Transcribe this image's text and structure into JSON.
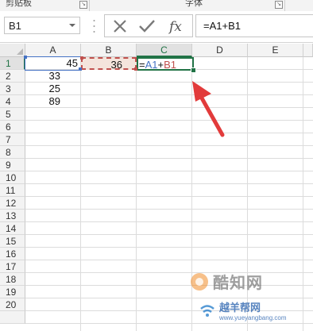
{
  "ribbon": {
    "groups": [
      {
        "label": "剪贴板"
      },
      {
        "label": "字体"
      }
    ]
  },
  "formula_bar": {
    "name_box": "B1",
    "formula": "=A1+B1"
  },
  "sheet": {
    "columns": [
      "A",
      "B",
      "C",
      "D",
      "E"
    ],
    "rows": [
      "1",
      "2",
      "3",
      "4",
      "5",
      "6",
      "7",
      "8",
      "9",
      "10",
      "11",
      "12",
      "13",
      "14",
      "15",
      "16",
      "17",
      "18",
      "19",
      "20"
    ],
    "active_cell": "C1",
    "cells": {
      "A1": "45",
      "A2": "33",
      "A3": "25",
      "A4": "89",
      "B1": "36"
    },
    "c1_formula": {
      "eq": "=",
      "ref_a": "A1",
      "op": "+",
      "ref_b": "B1"
    }
  },
  "colors": {
    "excel_green": "#217346",
    "ref_blue": "#4472c4",
    "ref_red": "#c0504d",
    "arrow_red": "#e23b3b"
  },
  "watermark": {
    "title": "酷知网",
    "subtitle": "越羊帮网",
    "url": "www.yueyangbang.com"
  }
}
